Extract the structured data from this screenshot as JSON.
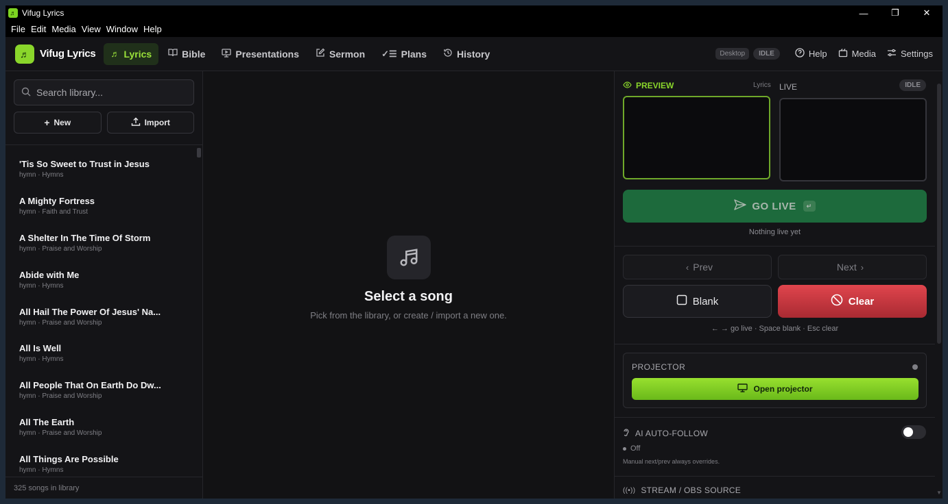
{
  "window": {
    "title": "Vifug Lyrics",
    "controls": [
      "—",
      "❐",
      "✕"
    ]
  },
  "menu": [
    "File",
    "Edit",
    "Media",
    "View",
    "Window",
    "Help"
  ],
  "nav": {
    "brand": "Vifug Lyrics",
    "tabs": [
      {
        "label": "Lyrics",
        "icon": "music-note-icon",
        "active": true
      },
      {
        "label": "Bible",
        "icon": "book-icon"
      },
      {
        "label": "Presentations",
        "icon": "presentation-icon"
      },
      {
        "label": "Sermon",
        "icon": "edit-note-icon"
      },
      {
        "label": "Plans",
        "icon": "checklist-icon"
      },
      {
        "label": "History",
        "icon": "history-icon"
      }
    ],
    "desktop_badge": "Desktop",
    "status_badge": "IDLE",
    "links": [
      {
        "label": "Help",
        "icon": "help-icon"
      },
      {
        "label": "Media",
        "icon": "media-icon"
      },
      {
        "label": "Settings",
        "icon": "settings-icon"
      }
    ]
  },
  "sidebar": {
    "search_placeholder": "Search library...",
    "new_label": "New",
    "import_label": "Import",
    "songs": [
      {
        "title": "'Tis So Sweet to Trust in Jesus",
        "subtitle": "hymn · Hymns"
      },
      {
        "title": "A Mighty Fortress",
        "subtitle": "hymn · Faith and Trust"
      },
      {
        "title": "A Shelter In The Time Of Storm",
        "subtitle": "hymn · Praise and Worship"
      },
      {
        "title": "Abide with Me",
        "subtitle": "hymn · Hymns"
      },
      {
        "title": "All Hail The Power Of Jesus' Na...",
        "subtitle": "hymn · Praise and Worship"
      },
      {
        "title": "All Is Well",
        "subtitle": "hymn · Hymns"
      },
      {
        "title": "All People That On Earth Do Dw...",
        "subtitle": "hymn · Praise and Worship"
      },
      {
        "title": "All The Earth",
        "subtitle": "hymn · Praise and Worship"
      },
      {
        "title": "All Things Are Possible",
        "subtitle": "hymn · Hymns"
      }
    ],
    "footer": "325 songs in library"
  },
  "center": {
    "title": "Select a song",
    "subtitle": "Pick from the library, or create / import a new one."
  },
  "right": {
    "preview_label": "PREVIEW",
    "preview_tag": "Lyrics",
    "live_label": "LIVE",
    "live_status": "IDLE",
    "go_live_label": "GO LIVE",
    "go_live_key": "↵",
    "nothing_live": "Nothing live yet",
    "prev_label": "Prev",
    "next_label": "Next",
    "blank_label": "Blank",
    "clear_label": "Clear",
    "shortcut_hint": "← → go live · Space blank · Esc clear",
    "projector_label": "PROJECTOR",
    "open_projector_label": "Open projector",
    "ai_label": "AI AUTO-FOLLOW",
    "ai_state": "Off",
    "ai_note": "Manual next/prev always overrides.",
    "stream_label": "STREAM / OBS SOURCE"
  },
  "colors": {
    "accent": "#8ad62b",
    "go_live": "#1d6a3c",
    "clear": "#d93c44"
  }
}
